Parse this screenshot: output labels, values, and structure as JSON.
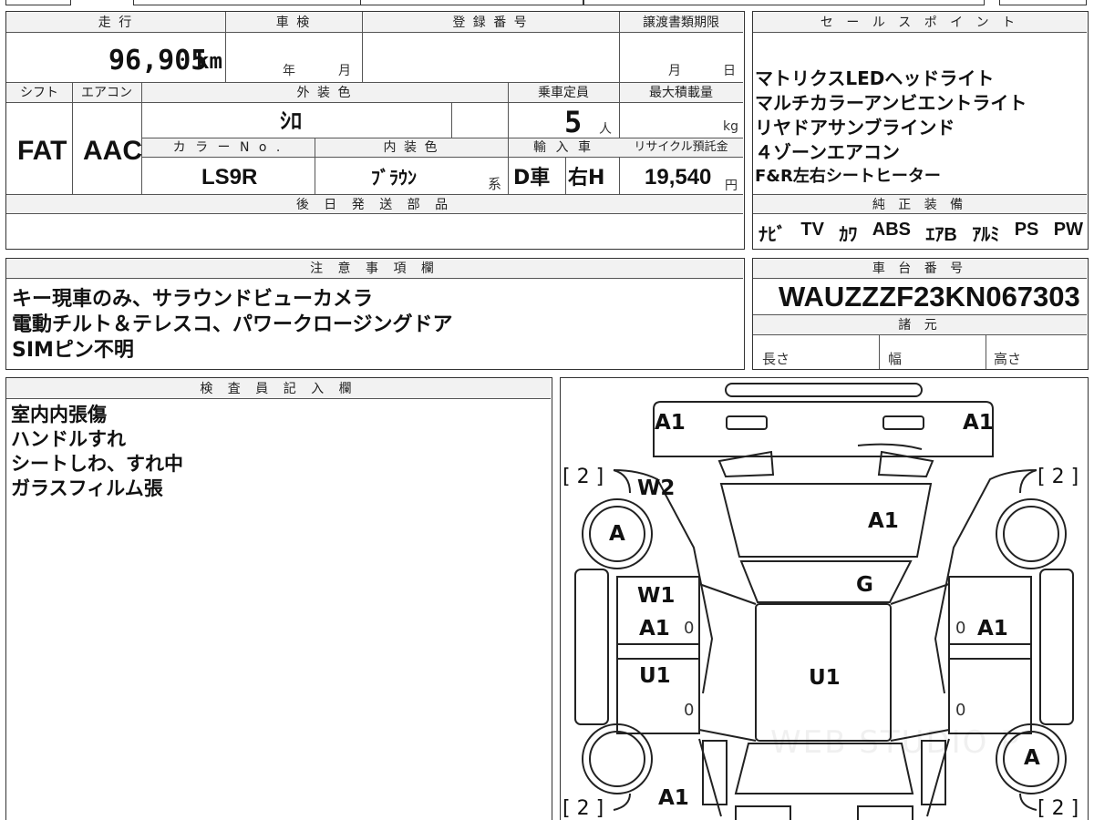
{
  "mileage": {
    "label": "走 行",
    "value": "96,905",
    "unit": "km"
  },
  "inspection": {
    "label": "車 検",
    "year_unit": "年",
    "month_unit": "月"
  },
  "registration": {
    "label": "登 録 番 号"
  },
  "transfer_deadline": {
    "label": "譲渡書類期限",
    "month_unit": "月",
    "day_unit": "日"
  },
  "shift": {
    "label": "シフト",
    "value": "FAT"
  },
  "aircon": {
    "label": "エアコン",
    "value": "AAC"
  },
  "exterior_color": {
    "label": "外 装 色",
    "value": "ｼﾛ"
  },
  "capacity": {
    "label": "乗車定員",
    "value": "5",
    "unit": "人"
  },
  "max_load": {
    "label": "最大積載量",
    "unit": "kg"
  },
  "color_no": {
    "label": "カ ラ ー N o .",
    "value": "LS9R"
  },
  "interior_color": {
    "label": "内 装 色",
    "value": "ﾌﾞﾗｳﾝ",
    "suffix": "系"
  },
  "import": {
    "label": "輸 入 車",
    "type": "D車",
    "steering": "右H"
  },
  "recycle": {
    "label": "リサイクル預託金",
    "value": "19,540",
    "unit": "円"
  },
  "later_parts": {
    "label": "後 日 発 送 部 品"
  },
  "sales_points": {
    "label": "セ ー ル ス ポ イ ン ト",
    "items": [
      "マトリクスLEDヘッドライト",
      "マルチカラーアンビエントライト",
      "リヤドアサンブラインド",
      "４ゾーンエアコン",
      "F&R左右シートヒーター"
    ]
  },
  "equipment": {
    "label": "純 正 装 備",
    "items": [
      "ﾅﾋﾞ",
      "TV",
      "ｶﾜ",
      "ABS",
      "ｴｱB",
      "ｱﾙﾐ",
      "PS",
      "PW"
    ]
  },
  "notes": {
    "label": "注 意 事 項 欄",
    "lines": [
      "キー現車のみ、サラウンドビューカメラ",
      "電動チルト＆テレスコ、パワークロージングドア",
      "SIMピン不明"
    ]
  },
  "chassis": {
    "label": "車 台 番 号",
    "value": "WAUZZZF23KN067303"
  },
  "specs": {
    "label": "諸 元",
    "length": "長さ",
    "width": "幅",
    "height": "高さ"
  },
  "inspector": {
    "label": "検 査 員 記 入 欄",
    "lines": [
      "室内内張傷",
      "ハンドルすれ",
      "シートしわ、すれ中",
      "ガラスフィルム張"
    ]
  },
  "diagram": {
    "front_left": "A1",
    "front_right": "A1",
    "tire_fl": "[ 2 ]",
    "tire_fr": "[ 2 ]",
    "tire_rl": "[ 2 ]",
    "tire_rr": "[ 2 ]",
    "wheel_fl": "A",
    "wheel_rr": "A",
    "fender_left": "W2",
    "hood": "A1",
    "windshield": "G",
    "door_fl_1": "W1",
    "door_fl_2": "A1",
    "door_fr": "A1",
    "door_rl": "U1",
    "roof": "U1",
    "rear": "A1",
    "zero1": "0",
    "zero2": "0",
    "zero3": "0",
    "zero4": "0"
  },
  "watermark": "WEB STUDIO P"
}
